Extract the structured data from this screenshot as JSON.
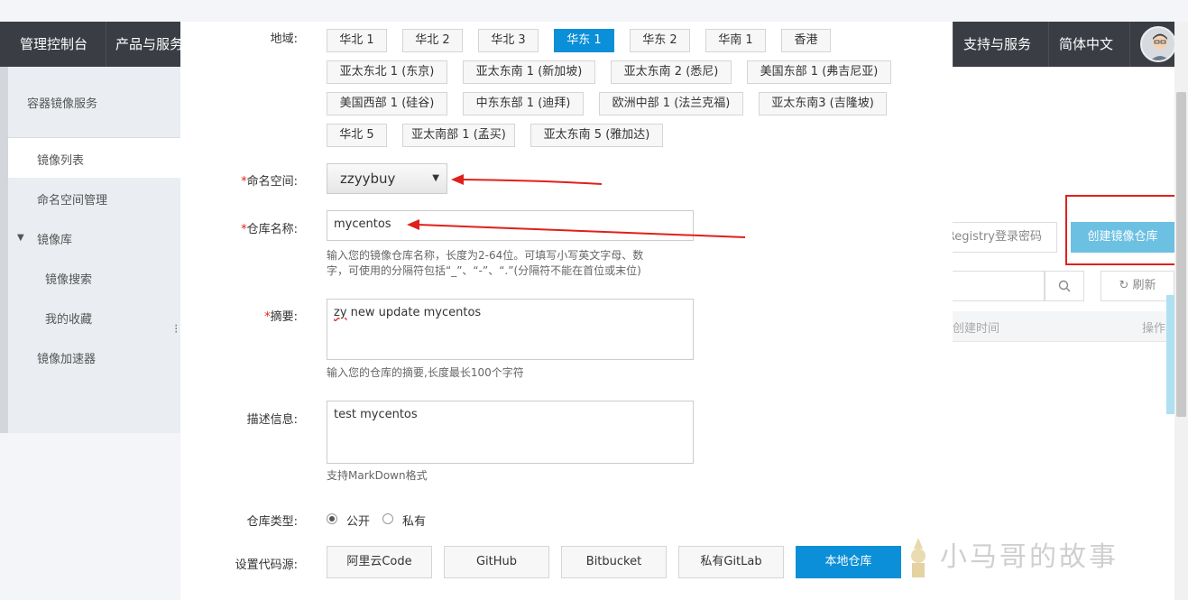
{
  "topbar": {
    "console": "管理控制台",
    "products": "产品与服务",
    "support": "支持与服务",
    "language": "简体中文"
  },
  "sidebar": {
    "title": "容器镜像服务",
    "items": [
      "镜像列表",
      "命名空间管理",
      "镜像库",
      "镜像搜索",
      "我的收藏",
      "镜像加速器"
    ]
  },
  "main": {
    "registry_button": "Registry登录密码",
    "create_button": "创建镜像仓库",
    "refresh_button": "刷新",
    "col_time": "创建时间",
    "col_ops": "操作"
  },
  "form": {
    "region_label": "地域:",
    "regions": [
      [
        "华北 1",
        "华北 2",
        "华北 3",
        "华东 1",
        "华东 2",
        "华南 1",
        "香港"
      ],
      [
        "亚太东北 1 (东京)",
        "亚太东南 1 (新加坡)",
        "亚太东南 2 (悉尼)",
        "美国东部 1 (弗吉尼亚)"
      ],
      [
        "美国西部 1 (硅谷)",
        "中东东部 1 (迪拜)",
        "欧洲中部 1 (法兰克福)",
        "亚太东南3 (吉隆坡)"
      ],
      [
        "华北 5",
        "亚太南部 1 (孟买)",
        "亚太东南 5 (雅加达)"
      ]
    ],
    "selected_region": "华东 1",
    "required_mark": "*",
    "namespace_label": "命名空间:",
    "namespace_value": "zzyybuy",
    "repo_name_label": "仓库名称:",
    "repo_name_value": "mycentos",
    "repo_name_hint_1": "输入您的镜像仓库名称，长度为2-64位。可填写小写英文字母、数",
    "repo_name_hint_2": "字，可使用的分隔符包括“_”、“-”、“.”(分隔符不能在首位或末位)",
    "summary_label": "摘要:",
    "summary_value_prefix": "zy",
    "summary_value_rest": " new update mycentos",
    "summary_hint": "输入您的仓库的摘要,长度最长100个字符",
    "desc_label": "描述信息:",
    "desc_value": "test mycentos",
    "desc_hint": "支持MarkDown格式",
    "type_label": "仓库类型:",
    "type_public": "公开",
    "type_private": "私有",
    "type_selected": "公开",
    "source_label": "设置代码源:",
    "sources": [
      "阿里云Code",
      "GitHub",
      "Bitbucket",
      "私有GitLab",
      "本地仓库"
    ],
    "selected_source": "本地仓库"
  },
  "watermark": "小马哥的故事",
  "colors": {
    "accent": "#0a8fd8",
    "annotation_red": "#e0201b",
    "topbar": "#3a3d44"
  }
}
